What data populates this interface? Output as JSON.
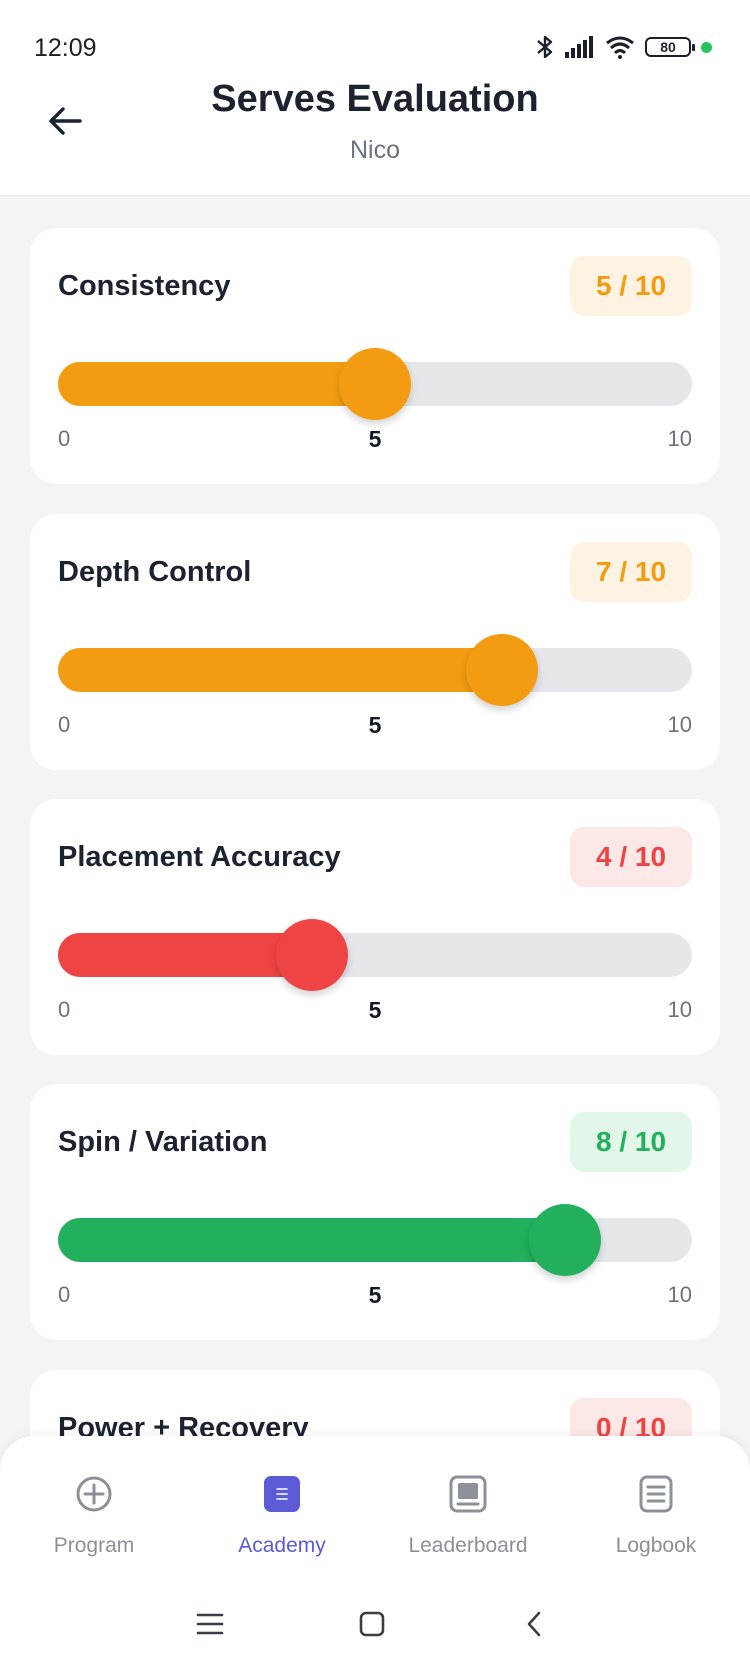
{
  "status": {
    "time": "12:09",
    "battery": "80"
  },
  "header": {
    "title": "Serves Evaluation",
    "subtitle": "Nico"
  },
  "scale": {
    "min": "0",
    "mid": "5",
    "max": "10"
  },
  "criteria": [
    {
      "label": "Consistency",
      "score": 5,
      "score_text": "5 / 10",
      "color": "#f39c12",
      "badge_bg": "#fef3e2"
    },
    {
      "label": "Depth Control",
      "score": 7,
      "score_text": "7 / 10",
      "color": "#f39c12",
      "badge_bg": "#fef3e2"
    },
    {
      "label": "Placement Accuracy",
      "score": 4,
      "score_text": "4 / 10",
      "color": "#ef4444",
      "badge_bg": "#fde8e8"
    },
    {
      "label": "Spin / Variation",
      "score": 8,
      "score_text": "8 / 10",
      "color": "#22b05d",
      "badge_bg": "#e3f6ea"
    },
    {
      "label": "Power + Recovery",
      "score": 0,
      "score_text": "0 / 10",
      "color": "#ef4444",
      "badge_bg": "#fde8e8"
    }
  ],
  "nav": [
    {
      "label": "Program",
      "icon": "plus-circle-icon",
      "active": false
    },
    {
      "label": "Academy",
      "icon": "academy-icon",
      "active": true
    },
    {
      "label": "Leaderboard",
      "icon": "leaderboard-icon",
      "active": false
    },
    {
      "label": "Logbook",
      "icon": "logbook-icon",
      "active": false
    }
  ],
  "colors": {
    "accent": "#5b5bd6"
  }
}
